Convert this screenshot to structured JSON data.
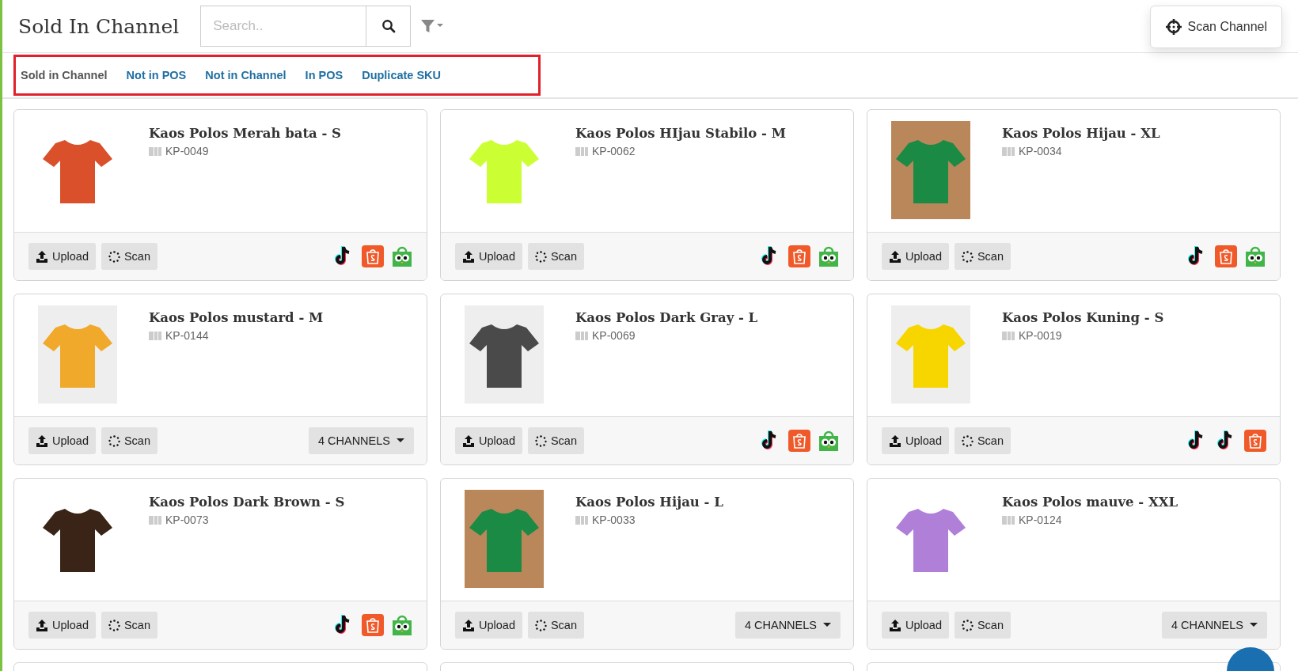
{
  "header": {
    "title": "Sold In Channel",
    "search": {
      "placeholder": "Search.."
    },
    "scan_button": "Scan Channel"
  },
  "tabs": [
    {
      "label": "Sold in Channel",
      "selected": true
    },
    {
      "label": "Not in POS",
      "selected": false
    },
    {
      "label": "Not in Channel",
      "selected": false
    },
    {
      "label": "In POS",
      "selected": false
    },
    {
      "label": "Duplicate SKU",
      "selected": false
    }
  ],
  "products": [
    {
      "name": "Kaos Polos Merah bata - S",
      "sku": "KP-0049",
      "color": "#d9502a",
      "kind": "cutout",
      "upload": "Upload",
      "scan": "Scan",
      "channels": [
        {
          "kind": "tiktok"
        },
        {
          "kind": "shopee"
        },
        {
          "kind": "tokopedia"
        }
      ]
    },
    {
      "name": "Kaos Polos HIjau Stabilo - M",
      "sku": "KP-0062",
      "color": "#ccff33",
      "kind": "cutout",
      "upload": "Upload",
      "scan": "Scan",
      "channels": [
        {
          "kind": "tiktok"
        },
        {
          "kind": "shopee"
        },
        {
          "kind": "tokopedia"
        }
      ]
    },
    {
      "name": "Kaos Polos Hijau - XL",
      "sku": "KP-0034",
      "color": "#1a8a45",
      "kind": "wood",
      "upload": "Upload",
      "scan": "Scan",
      "channels": [
        {
          "kind": "tiktok"
        },
        {
          "kind": "shopee"
        },
        {
          "kind": "tokopedia"
        }
      ]
    },
    {
      "name": "Kaos Polos mustard - M",
      "sku": "KP-0144",
      "color": "#f0a92a",
      "kind": "studio",
      "upload": "Upload",
      "scan": "Scan",
      "channels_menu": "4 CHANNELS"
    },
    {
      "name": "Kaos Polos Dark Gray - L",
      "sku": "KP-0069",
      "color": "#4a4a4a",
      "kind": "studio",
      "upload": "Upload",
      "scan": "Scan",
      "channels": [
        {
          "kind": "tiktok"
        },
        {
          "kind": "shopee"
        },
        {
          "kind": "tokopedia"
        }
      ]
    },
    {
      "name": "Kaos Polos Kuning - S",
      "sku": "KP-0019",
      "color": "#f7d600",
      "kind": "studio",
      "upload": "Upload",
      "scan": "Scan",
      "channels": [
        {
          "kind": "tiktok"
        },
        {
          "kind": "tiktok"
        },
        {
          "kind": "shopee"
        }
      ]
    },
    {
      "name": "Kaos Polos Dark Brown - S",
      "sku": "KP-0073",
      "color": "#3a2418",
      "kind": "cutout",
      "upload": "Upload",
      "scan": "Scan",
      "channels": [
        {
          "kind": "tiktok"
        },
        {
          "kind": "shopee"
        },
        {
          "kind": "tokopedia"
        }
      ]
    },
    {
      "name": "Kaos Polos Hijau - L",
      "sku": "KP-0033",
      "color": "#1a8a45",
      "kind": "wood",
      "upload": "Upload",
      "scan": "Scan",
      "channels_menu": "4 CHANNELS"
    },
    {
      "name": "Kaos Polos mauve - XXL",
      "sku": "KP-0124",
      "color": "#b07fd8",
      "kind": "cutout",
      "upload": "Upload",
      "scan": "Scan",
      "channels_menu": "4 CHANNELS"
    }
  ]
}
